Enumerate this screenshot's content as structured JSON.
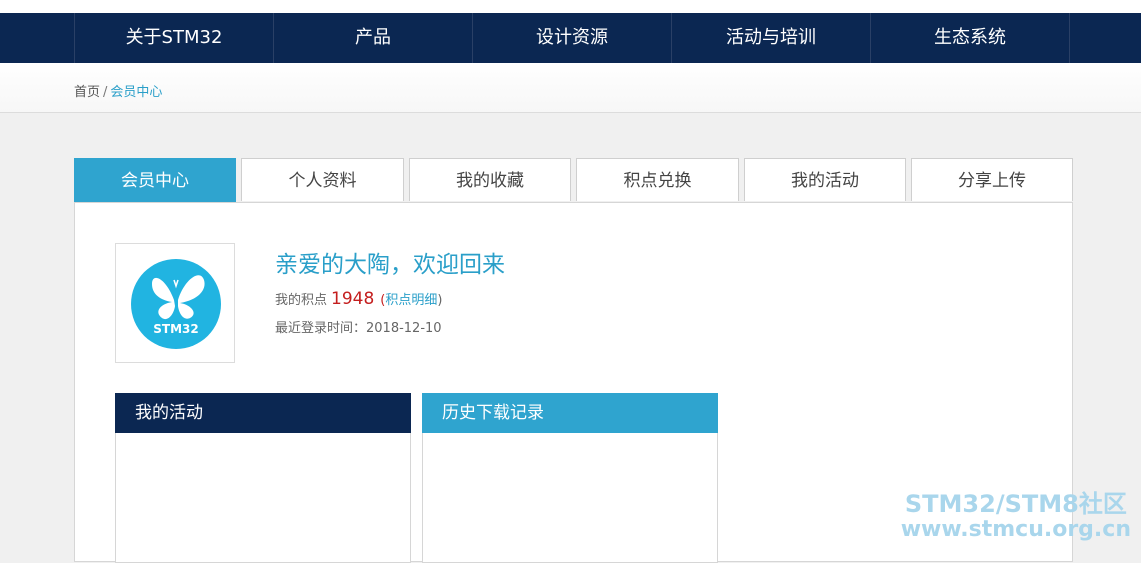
{
  "nav": {
    "items": [
      {
        "label": "关于STM32"
      },
      {
        "label": "产品"
      },
      {
        "label": "设计资源"
      },
      {
        "label": "活动与培训"
      },
      {
        "label": "生态系统"
      }
    ]
  },
  "breadcrumb": {
    "home": "首页",
    "separator": "/",
    "current": "会员中心"
  },
  "tabs": [
    {
      "label": "会员中心",
      "active": true
    },
    {
      "label": "个人资料",
      "active": false
    },
    {
      "label": "我的收藏",
      "active": false
    },
    {
      "label": "积点兑换",
      "active": false
    },
    {
      "label": "我的活动",
      "active": false
    },
    {
      "label": "分享上传",
      "active": false
    }
  ],
  "profile": {
    "avatar_logo_text": "STM32",
    "welcome": "亲爱的大陶，欢迎回来",
    "points_label": "我的积点",
    "points_value": "1948",
    "points_link_open": "(",
    "points_link": "积点明细",
    "points_link_close": ")",
    "last_login_label": "最近登录时间：",
    "last_login_value": "2018-12-10"
  },
  "boxes": {
    "my_activities": "我的活动",
    "download_history": "历史下载记录"
  },
  "watermark": {
    "line1": "STM32/STM8社区",
    "line2": "www.stmcu.org.cn"
  },
  "colors": {
    "nav_bg": "#0b2752",
    "accent": "#2fa4cf",
    "points_red": "#c41e1e"
  }
}
